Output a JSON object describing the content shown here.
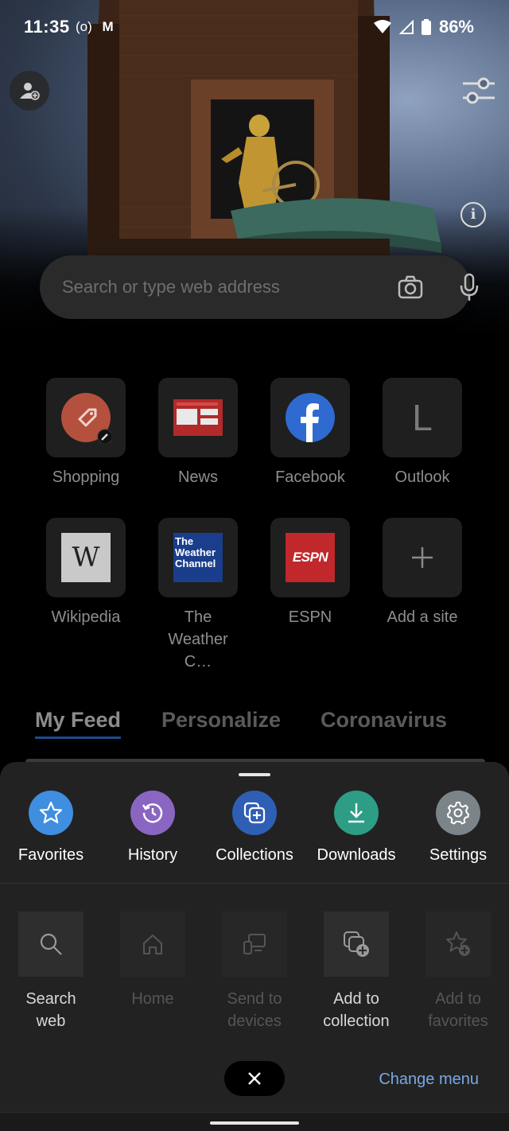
{
  "status_bar": {
    "time": "11:35",
    "battery": "86%"
  },
  "search": {
    "placeholder": "Search or type web address"
  },
  "top_sites": [
    {
      "label": "Shopping"
    },
    {
      "label": "News"
    },
    {
      "label": "Facebook"
    },
    {
      "label": "Outlook",
      "letter": "L"
    },
    {
      "label": "Wikipedia",
      "letter": "W"
    },
    {
      "label": "The Weather C…",
      "logo_lines": [
        "The",
        "Weather",
        "Channel"
      ]
    },
    {
      "label": "ESPN",
      "logo_text": "ESPN"
    },
    {
      "label": "Add a site"
    }
  ],
  "feed_tabs": [
    "My Feed",
    "Personalize",
    "Coronavirus"
  ],
  "menu": {
    "quick_actions": [
      {
        "label": "Favorites",
        "icon": "star-icon",
        "color": "#3f8ee0"
      },
      {
        "label": "History",
        "icon": "history-icon",
        "color": "#8a66c2"
      },
      {
        "label": "Collections",
        "icon": "collections-icon",
        "color": "#2f5fb5"
      },
      {
        "label": "Downloads",
        "icon": "download-icon",
        "color": "#2d9d86"
      },
      {
        "label": "Settings",
        "icon": "gear-icon",
        "color": "#7b8489"
      }
    ],
    "actions": [
      {
        "label": "Search web",
        "enabled": true
      },
      {
        "label": "Home",
        "enabled": false
      },
      {
        "label": "Send to devices",
        "enabled": false
      },
      {
        "label": "Add to collection",
        "enabled": true
      },
      {
        "label": "Add to favorites",
        "enabled": false
      }
    ],
    "change_menu_label": "Change menu"
  }
}
